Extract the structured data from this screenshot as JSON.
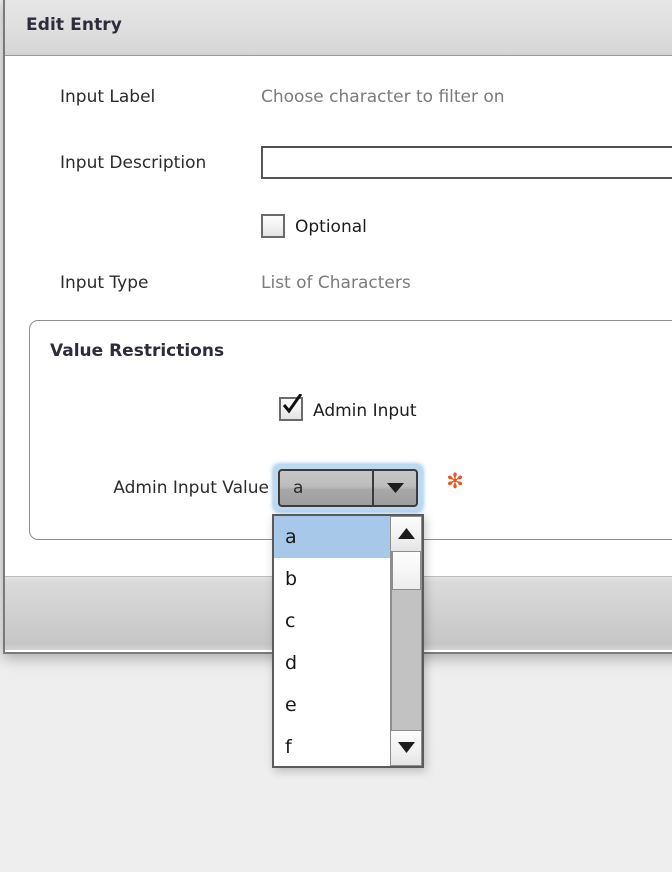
{
  "window": {
    "title": "Edit Entry"
  },
  "form": {
    "input_label": {
      "label": "Input Label",
      "value": "Choose character to filter on"
    },
    "input_description": {
      "label": "Input Description",
      "value": "",
      "placeholder": ""
    },
    "optional": {
      "label": "Optional",
      "checked": false
    },
    "input_type": {
      "label": "Input Type",
      "value": "List of Characters"
    }
  },
  "value_restrictions": {
    "title": "Value Restrictions",
    "admin_input": {
      "label": "Admin Input",
      "checked": true
    },
    "admin_input_value": {
      "label": "Admin Input Value",
      "selected": "a",
      "required_marker": "✻",
      "options": [
        "a",
        "b",
        "c",
        "d",
        "e",
        "f"
      ],
      "dropdown_open": true
    }
  },
  "icons": {
    "combo_arrow": "chevron-down-icon",
    "scroll_up": "scroll-up-arrow-icon",
    "scroll_down": "scroll-down-arrow-icon",
    "checkmark": "check-icon",
    "required": "required-asterisk-icon"
  },
  "colors": {
    "titlebar_text": "#2c2c3a",
    "label_text": "#2b2b2b",
    "value_text": "#7b7b7b",
    "selection_blue": "#a8c8ea",
    "focus_glow": "#bcd9f2",
    "required_orange": "#ea5520",
    "panel_border": "#8d8d8d"
  }
}
